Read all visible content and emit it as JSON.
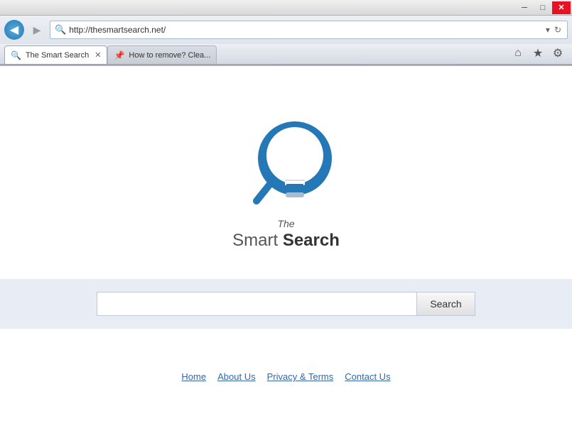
{
  "titlebar": {
    "minimize_label": "─",
    "maximize_label": "□",
    "close_label": "✕"
  },
  "navbar": {
    "url": "http://thesmartsearch.net/",
    "search_icon": "🔍",
    "back_icon": "◀",
    "forward_icon": "▶",
    "refresh_icon": "↻",
    "search_action_icon": "▾"
  },
  "tabs": [
    {
      "label": "The Smart Search",
      "favicon": "🔍",
      "active": true,
      "closable": true
    },
    {
      "label": "How to remove? Clea...",
      "favicon": "📌",
      "active": false,
      "closable": false
    }
  ],
  "toolbar": {
    "home_icon": "⌂",
    "favorites_icon": "★",
    "settings_icon": "⚙"
  },
  "page": {
    "logo": {
      "alt": "The Smart Search Logo"
    },
    "title_the": "The",
    "title_smart": "Smart ",
    "title_search": "Search"
  },
  "search": {
    "placeholder": "",
    "button_label": "Search"
  },
  "footer": {
    "links": [
      {
        "label": "Home"
      },
      {
        "label": "About Us"
      },
      {
        "label": "Privacy & Terms"
      },
      {
        "label": "Contact Us"
      }
    ]
  }
}
